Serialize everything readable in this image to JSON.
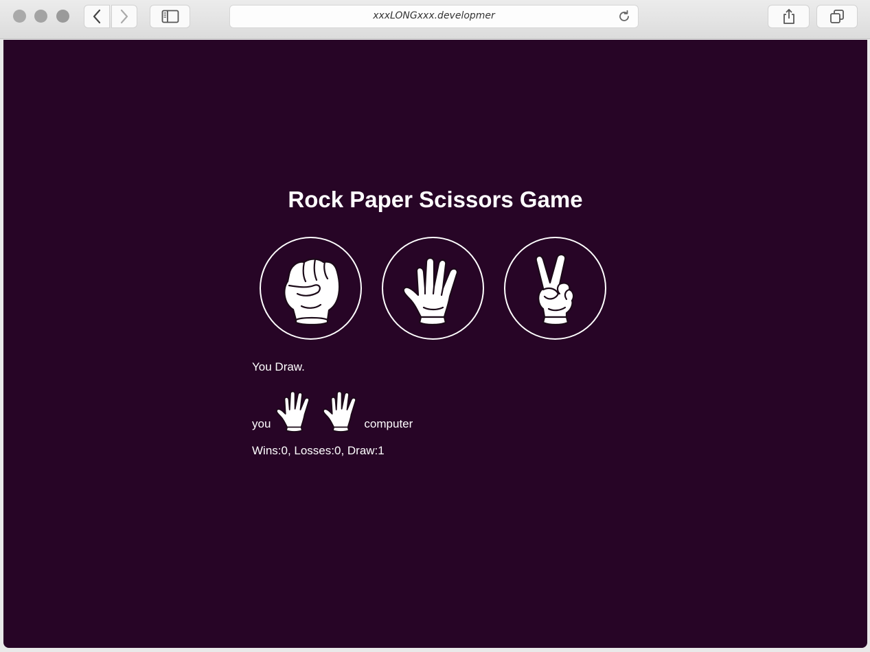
{
  "browser": {
    "url": "xxxLONGxxx.developmer",
    "icons": [
      "back-arrow-icon",
      "forward-arrow-icon",
      "sidebar-icon",
      "reload-icon",
      "share-icon",
      "tabs-icon"
    ]
  },
  "page": {
    "background": "#270526",
    "title": "Rock Paper Scissors Game",
    "choices": [
      {
        "name": "rock",
        "icon": "fist-hand-icon"
      },
      {
        "name": "paper",
        "icon": "open-hand-icon"
      },
      {
        "name": "scissors",
        "icon": "peace-hand-icon"
      }
    ],
    "result": "You Draw.",
    "you_label": "you",
    "computer_label": "computer",
    "player_move_icon": "open-hand-icon",
    "computer_move_icon": "open-hand-icon",
    "score": "Wins:0, Losses:0, Draw:1"
  }
}
